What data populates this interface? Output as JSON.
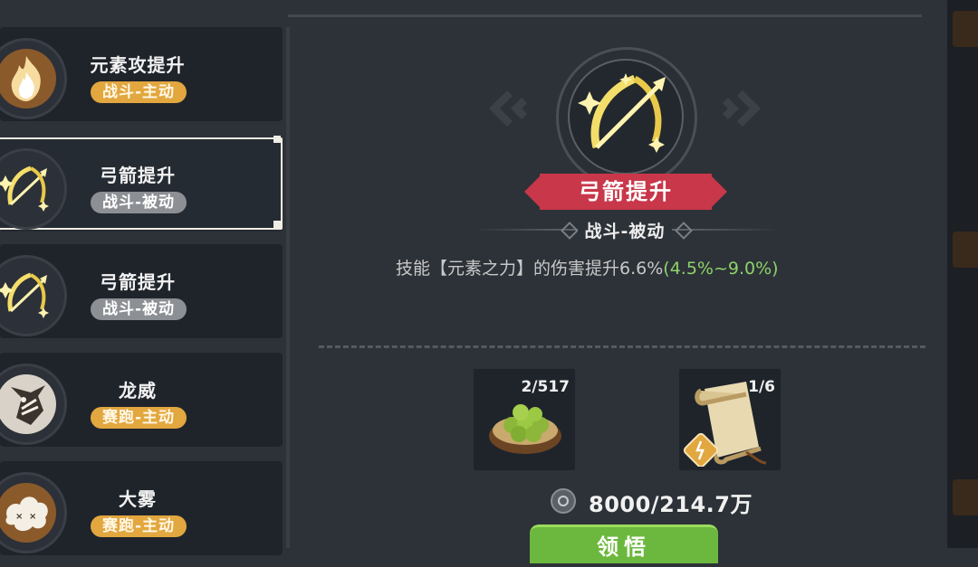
{
  "skill_list": [
    {
      "title": "元素攻提升",
      "badge": "战斗-主动",
      "badge_style": "gold",
      "icon": "fire-icon",
      "selected": false
    },
    {
      "title": "弓箭提升",
      "badge": "战斗-被动",
      "badge_style": "grey",
      "icon": "bow-arrow-icon",
      "selected": true
    },
    {
      "title": "弓箭提升",
      "badge": "战斗-被动",
      "badge_style": "grey",
      "icon": "bow-arrow-icon",
      "selected": false
    },
    {
      "title": "龙威",
      "badge": "赛跑-主动",
      "badge_style": "gold",
      "icon": "dragon-head-icon",
      "selected": false
    },
    {
      "title": "大雾",
      "badge": "赛跑-主动",
      "badge_style": "gold",
      "icon": "fog-cloud-icon",
      "selected": false
    }
  ],
  "detail": {
    "icon": "bow-arrow-icon",
    "name": "弓箭提升",
    "type": "战斗-被动",
    "description": "技能【元素之力】的伤害提升6.6%",
    "description_range": "(4.5%~9.0%)"
  },
  "materials": [
    {
      "icon": "green-fruit-bowl-icon",
      "count": "2/517"
    },
    {
      "icon": "scroll-icon",
      "count": "1/6"
    }
  ],
  "cost": {
    "icon": "coin-icon",
    "text": "8000/214.7万"
  },
  "learn_button": {
    "label": "领悟"
  },
  "colors": {
    "background": "#2d3238",
    "card": "#1f242b",
    "badge_gold": "#e2a73f",
    "badge_grey": "#8c8f94",
    "ribbon_red": "#c8374a",
    "range_green": "#8ed26a",
    "button_green": "#6cb83e"
  }
}
